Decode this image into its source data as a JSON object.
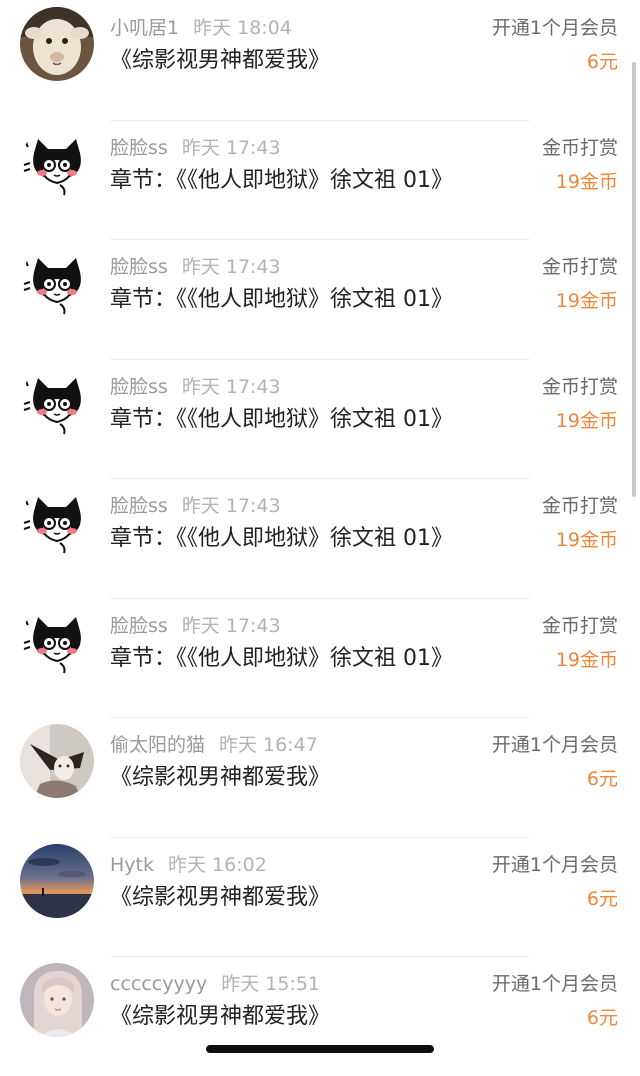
{
  "colors": {
    "accent": "#f0863a",
    "username": "#9a9a9a",
    "title": "#222222",
    "type_label": "#6a6a6a"
  },
  "items": [
    {
      "avatar": "sheep-avatar",
      "user": "小叽居1",
      "time": "昨天 18:04",
      "title": "《综影视男神都爱我》",
      "type": "开通1个月会员",
      "amount": "6元"
    },
    {
      "avatar": "cat-meme-avatar",
      "user": "脸脸ss",
      "time": "昨天 17:43",
      "title": "章节：《《他人即地狱》徐文祖 01》",
      "type": "金币打赏",
      "amount": "19金币"
    },
    {
      "avatar": "cat-meme-avatar",
      "user": "脸脸ss",
      "time": "昨天 17:43",
      "title": "章节：《《他人即地狱》徐文祖 01》",
      "type": "金币打赏",
      "amount": "19金币"
    },
    {
      "avatar": "cat-meme-avatar",
      "user": "脸脸ss",
      "time": "昨天 17:43",
      "title": "章节：《《他人即地狱》徐文祖 01》",
      "type": "金币打赏",
      "amount": "19金币"
    },
    {
      "avatar": "cat-meme-avatar",
      "user": "脸脸ss",
      "time": "昨天 17:43",
      "title": "章节：《《他人即地狱》徐文祖 01》",
      "type": "金币打赏",
      "amount": "19金币"
    },
    {
      "avatar": "cat-meme-avatar",
      "user": "脸脸ss",
      "time": "昨天 17:43",
      "title": "章节：《《他人即地狱》徐文祖 01》",
      "type": "金币打赏",
      "amount": "19金币"
    },
    {
      "avatar": "photo-avatar-cat",
      "user": "偷太阳的猫",
      "time": "昨天 16:47",
      "title": "《综影视男神都爱我》",
      "type": "开通1个月会员",
      "amount": "6元"
    },
    {
      "avatar": "sunset-avatar",
      "user": "Hytk",
      "time": "昨天 16:02",
      "title": "《综影视男神都爱我》",
      "type": "开通1个月会员",
      "amount": "6元"
    },
    {
      "avatar": "girl-avatar",
      "user": "cccccyyyy",
      "time": "昨天 15:51",
      "title": "《综影视男神都爱我》",
      "type": "开通1个月会员",
      "amount": "6元"
    }
  ]
}
